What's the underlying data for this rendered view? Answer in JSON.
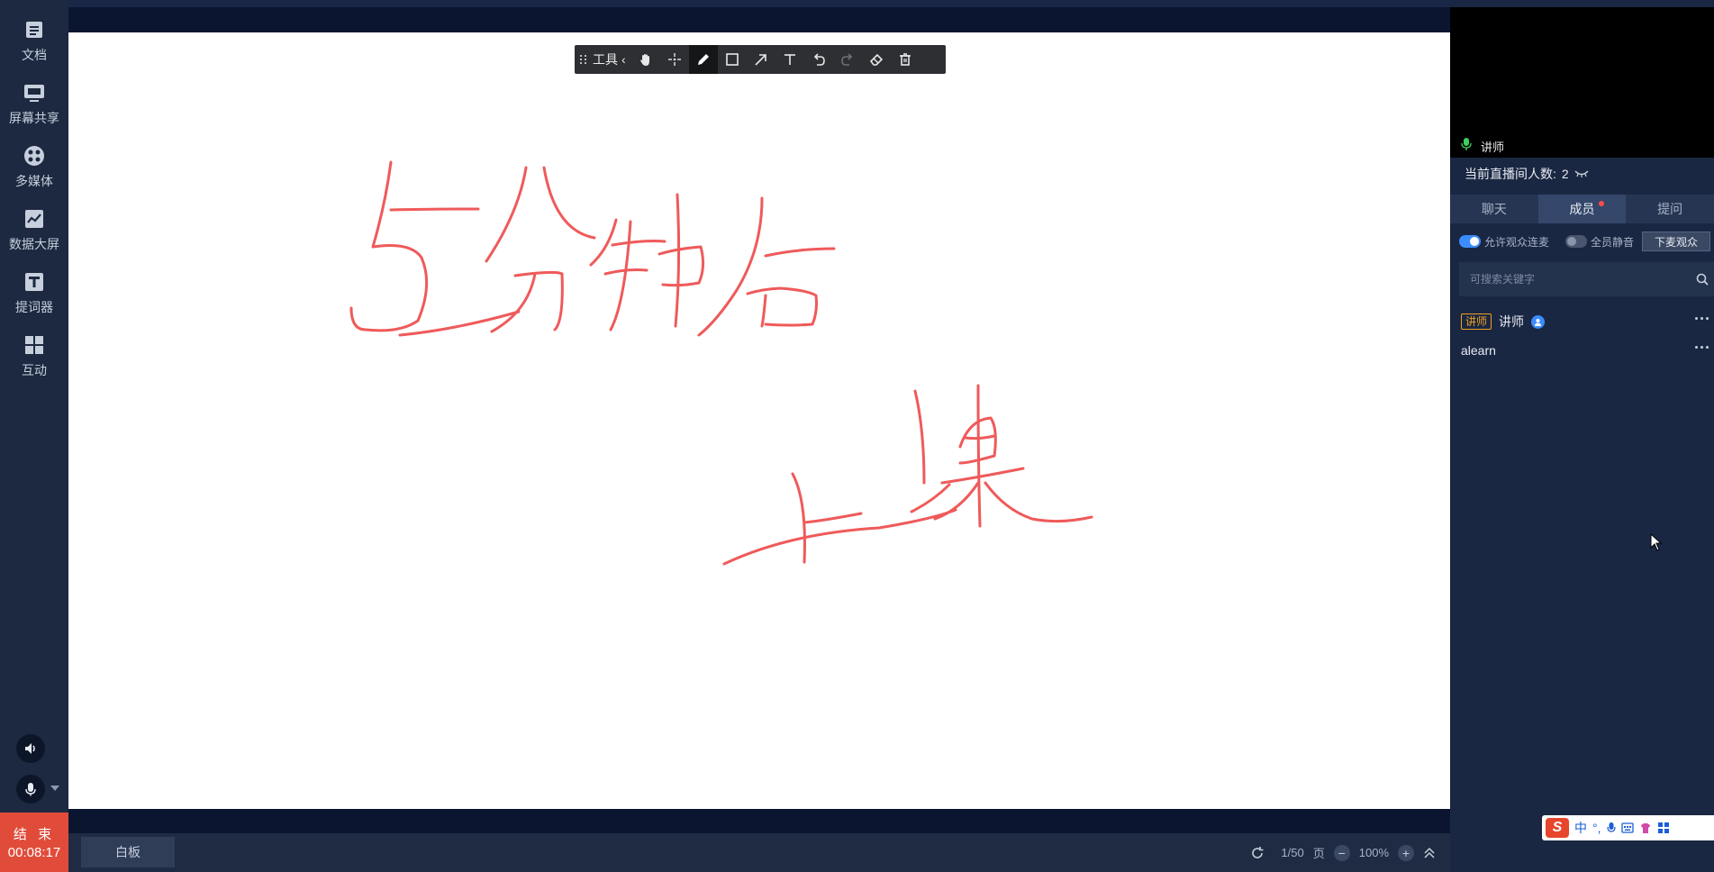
{
  "sidebar": {
    "items": [
      {
        "label": "文档",
        "icon": "document-icon"
      },
      {
        "label": "屏幕共享",
        "icon": "screen-share-icon"
      },
      {
        "label": "多媒体",
        "icon": "multimedia-icon"
      },
      {
        "label": "数据大屏",
        "icon": "data-screen-icon"
      },
      {
        "label": "提词器",
        "icon": "teleprompter-icon"
      },
      {
        "label": "互动",
        "icon": "interaction-icon"
      }
    ],
    "end_label": "结 束",
    "timer": "00:08:17"
  },
  "toolbar": {
    "label": "工具",
    "tools": [
      "hand-icon",
      "move-icon",
      "pen-icon",
      "rectangle-icon",
      "arrow-icon",
      "text-icon",
      "undo-icon",
      "redo-icon",
      "eraser-icon",
      "trash-icon"
    ],
    "active_tool": "pen-icon"
  },
  "whiteboard": {
    "tab_label": "白板",
    "page": "1/50",
    "page_unit": "页",
    "zoom": "100%"
  },
  "right_panel": {
    "video_name": "讲师",
    "viewers_label": "当前直播间人数:",
    "viewers_count": "2",
    "tabs": [
      {
        "label": "聊天",
        "active": false
      },
      {
        "label": "成员",
        "active": true,
        "has_dot": true
      },
      {
        "label": "提问",
        "active": false
      }
    ],
    "allow_mic_label": "允许观众连麦",
    "allow_mic_on": true,
    "mute_all_label": "全员静音",
    "mute_all_on": false,
    "down_button": "下麦观众",
    "search_placeholder": "可搜索关键字",
    "members": [
      {
        "role": "讲师",
        "name": "讲师",
        "is_host": true
      },
      {
        "role": "",
        "name": "alearn",
        "is_host": false
      }
    ]
  },
  "ime": {
    "mode": "中"
  },
  "colors": {
    "ink": "#ef5a5a",
    "accent": "#3b8cff",
    "end": "#e14c3a"
  }
}
